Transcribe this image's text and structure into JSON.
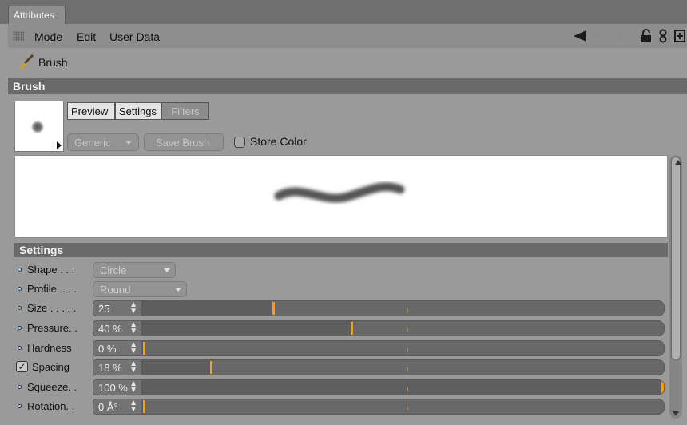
{
  "tab": {
    "label": "Attributes"
  },
  "menu": {
    "mode": "Mode",
    "edit": "Edit",
    "user_data": "User Data"
  },
  "object": {
    "name": "Brush"
  },
  "brush_section": {
    "title": "Brush"
  },
  "brush_tabs": {
    "preview": "Preview",
    "settings": "Settings",
    "filters": "Filters"
  },
  "preset": {
    "value": "Generic",
    "save": "Save Brush",
    "store_color": "Store Color",
    "store_color_checked": false
  },
  "settings_section": {
    "title": "Settings"
  },
  "params": {
    "shape": {
      "label": "Shape . . .",
      "value": "Circle"
    },
    "profile": {
      "label": "Profile. . . .",
      "value": "Round"
    },
    "size": {
      "label": "Size . . . . .",
      "value": "25",
      "level": 0.25
    },
    "pressure": {
      "label": "Pressure. .",
      "value": "40 %",
      "level": 0.4
    },
    "hardness": {
      "label": "Hardness",
      "value": "0 %",
      "level": 0.0
    },
    "spacing": {
      "label": "Spacing",
      "value": "18 %",
      "level": 0.13,
      "enabled": true
    },
    "squeeze": {
      "label": "Squeeze. .",
      "value": "100 %",
      "level": 1.0
    },
    "rotation": {
      "label": "Rotation. .",
      "value": "0 Â°",
      "level": 0.0
    }
  },
  "colors": {
    "accent": "#f2a400",
    "section_bg": "#6a6a6a",
    "panel_bg": "#9a9a9a"
  }
}
